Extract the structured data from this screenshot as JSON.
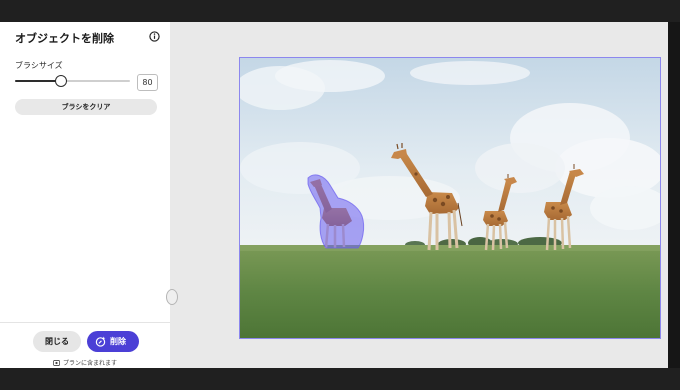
{
  "panel": {
    "title": "オブジェクトを削除",
    "brush": {
      "label": "ブラシサイズ",
      "value": "80",
      "level_fraction": 0.4
    },
    "clear_button": "ブラシをクリア",
    "close_button": "閉じる",
    "delete_button": "削除",
    "plan_note": "プランに含まれます"
  },
  "icons": {
    "info": "info-icon",
    "delete": "eraser-sparkle-icon",
    "plan": "credit-icon"
  },
  "colors": {
    "accent": "#4b3fd6",
    "selection_mask": "#6a5cf0"
  }
}
